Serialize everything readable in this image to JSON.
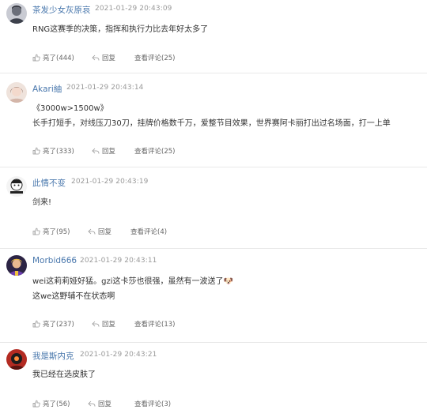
{
  "comments": [
    {
      "username": "茶发少女灰原哀",
      "time": "2021-01-29 20:43:09",
      "lines": [
        "RNG这赛季的决策，指挥和执行力比去年好太多了"
      ],
      "likes": "亮了(444)",
      "reply": "回复",
      "view_replies": "查看评论(25)",
      "avatar_color": "#6b6f7a"
    },
    {
      "username": "Akari紬",
      "time": "2021-01-29 20:43:14",
      "lines": [
        "《3000w>1500w》",
        "长手打短手，对线压刀30刀，挂牌价格数千万，爱整节目效果，世界赛阿卡丽打出过名场面，打一上单"
      ],
      "likes": "亮了(333)",
      "reply": "回复",
      "view_replies": "查看评论(25)",
      "avatar_color": "#d9c3b8"
    },
    {
      "username": "此情不变",
      "time": "2021-01-29 20:43:19",
      "lines": [
        "剑来!"
      ],
      "likes": "亮了(95)",
      "reply": "回复",
      "view_replies": "查看评论(4)",
      "avatar_color": "#f2f2f2"
    },
    {
      "username": "Morbid666",
      "time": "2021-01-29 20:43:11",
      "lines": [
        "wei这莉莉娅好猛。gzi这卡莎也很强，虽然有一波送了🐶",
        "这we这野辅不在状态啊"
      ],
      "likes": "亮了(237)",
      "reply": "回复",
      "view_replies": "查看评论(13)",
      "avatar_color": "#3b2f5a"
    },
    {
      "username": "我是斯内克",
      "time": "2021-01-29 20:43:21",
      "lines": [
        "我已经在选皮肤了"
      ],
      "likes": "亮了(56)",
      "reply": "回复",
      "view_replies": "查看评论(3)",
      "avatar_color": "#b32b22"
    }
  ]
}
